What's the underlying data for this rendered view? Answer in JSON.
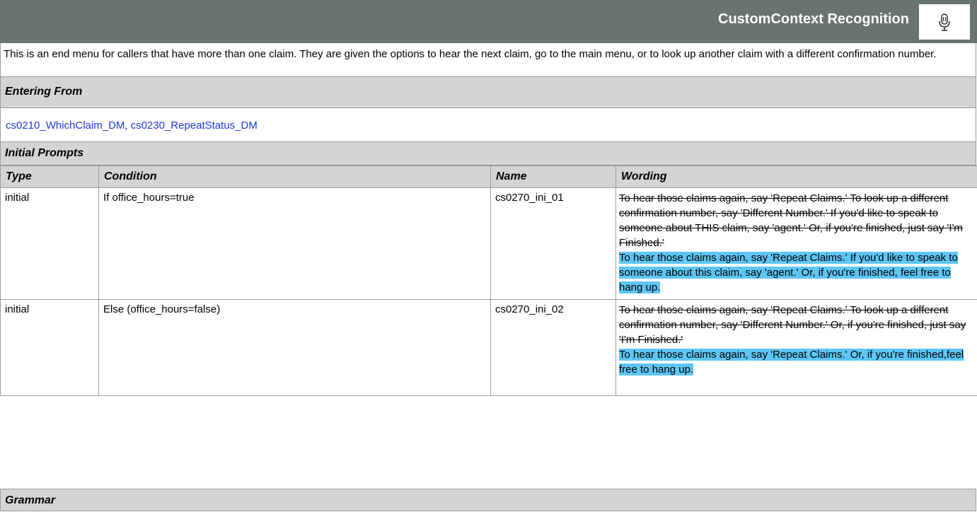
{
  "header": {
    "title": "CustomContext Recognition",
    "icon": "microphone-icon"
  },
  "description": "This is an end menu for callers that have more than one claim.  They are given the options to hear the next claim, go to the main menu, or to look up another claim with a different confirmation number.",
  "entering_from": {
    "label": "Entering From",
    "links": [
      "cs0210_WhichClaim_DM",
      "cs0230_RepeatStatus_DM"
    ],
    "separator": ","
  },
  "initial_prompts": {
    "label": "Initial Prompts",
    "columns": [
      "Type",
      "Condition",
      "Name",
      "Wording"
    ],
    "rows": [
      {
        "type": "initial",
        "condition": "If office_hours=true",
        "name": "cs0270_ini_01",
        "wording_old": "To hear those claims again, say 'Repeat Claims.'  To look up a different confirmation number, say 'Different Number.' If you'd like to speak to someone about THIS claim, say 'agent.' Or, if you're finished, just say 'I'm Finished.'",
        "wording_new": "To hear those claims again, say 'Repeat Claims.' If you'd like to speak to someone about this claim, say 'agent.' Or, if you're finished, feel free to hang up."
      },
      {
        "type": "initial",
        "condition": "Else (office_hours=false)",
        "name": "cs0270_ini_02",
        "wording_old": "To hear those claims again, say 'Repeat Claims.' To look up a different confirmation number, say 'Different Number.' Or, if you're finished, just say 'I'm Finished.'",
        "wording_new": "To hear those claims again, say 'Repeat Claims.' Or, if you're finished,feel free to hang up."
      }
    ]
  },
  "grammar": {
    "label": "Grammar"
  },
  "colors": {
    "header": "#697372",
    "section": "#d4d4d4",
    "link": "#1f38d6",
    "highlight": "#5ec6f5"
  }
}
